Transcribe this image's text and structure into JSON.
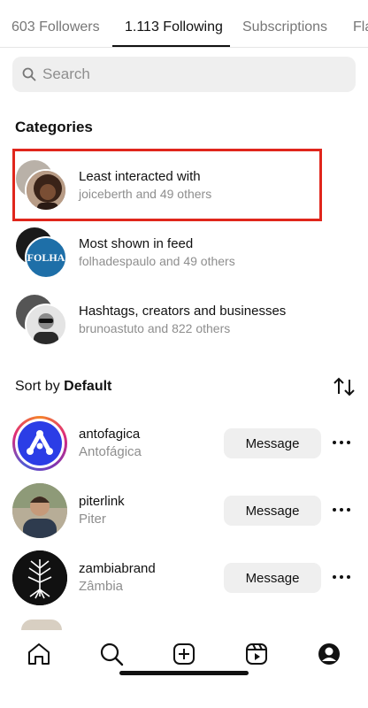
{
  "tabs": [
    {
      "label": "603 Followers",
      "active": false
    },
    {
      "label": "1.113 Following",
      "active": true
    },
    {
      "label": "Subscriptions",
      "active": false
    },
    {
      "label": "Fla",
      "active": false
    }
  ],
  "search": {
    "placeholder": "Search",
    "icon": "search-icon"
  },
  "categories": {
    "title": "Categories",
    "items": [
      {
        "name": "Least interacted with",
        "subtitle": "joiceberth and 49 others"
      },
      {
        "name": "Most shown in feed",
        "subtitle": "folhadespaulo and 49 others",
        "avatar_text": "FOLHA"
      },
      {
        "name": "Hashtags, creators and businesses",
        "subtitle": "brunoastuto and 822 others"
      }
    ]
  },
  "sort": {
    "prefix": "Sort by",
    "value": "Default",
    "icon": "sort-arrows-icon"
  },
  "following": [
    {
      "username": "antofagica",
      "fullname": "Antofágica",
      "button": "Message",
      "has_story_ring": true
    },
    {
      "username": "piterlink",
      "fullname": "Piter",
      "button": "Message",
      "has_story_ring": false
    },
    {
      "username": "zambiabrand",
      "fullname": "Zâmbia",
      "button": "Message",
      "has_story_ring": false
    }
  ],
  "bottom_nav": [
    "home-icon",
    "search-icon",
    "create-icon",
    "reels-icon",
    "profile-icon"
  ],
  "colors": {
    "highlight": "#e0261c",
    "accent_blue": "#2b3de6",
    "folha_blue": "#1e6fa8",
    "muted": "#8e8e8e",
    "button_bg": "#efefef"
  }
}
